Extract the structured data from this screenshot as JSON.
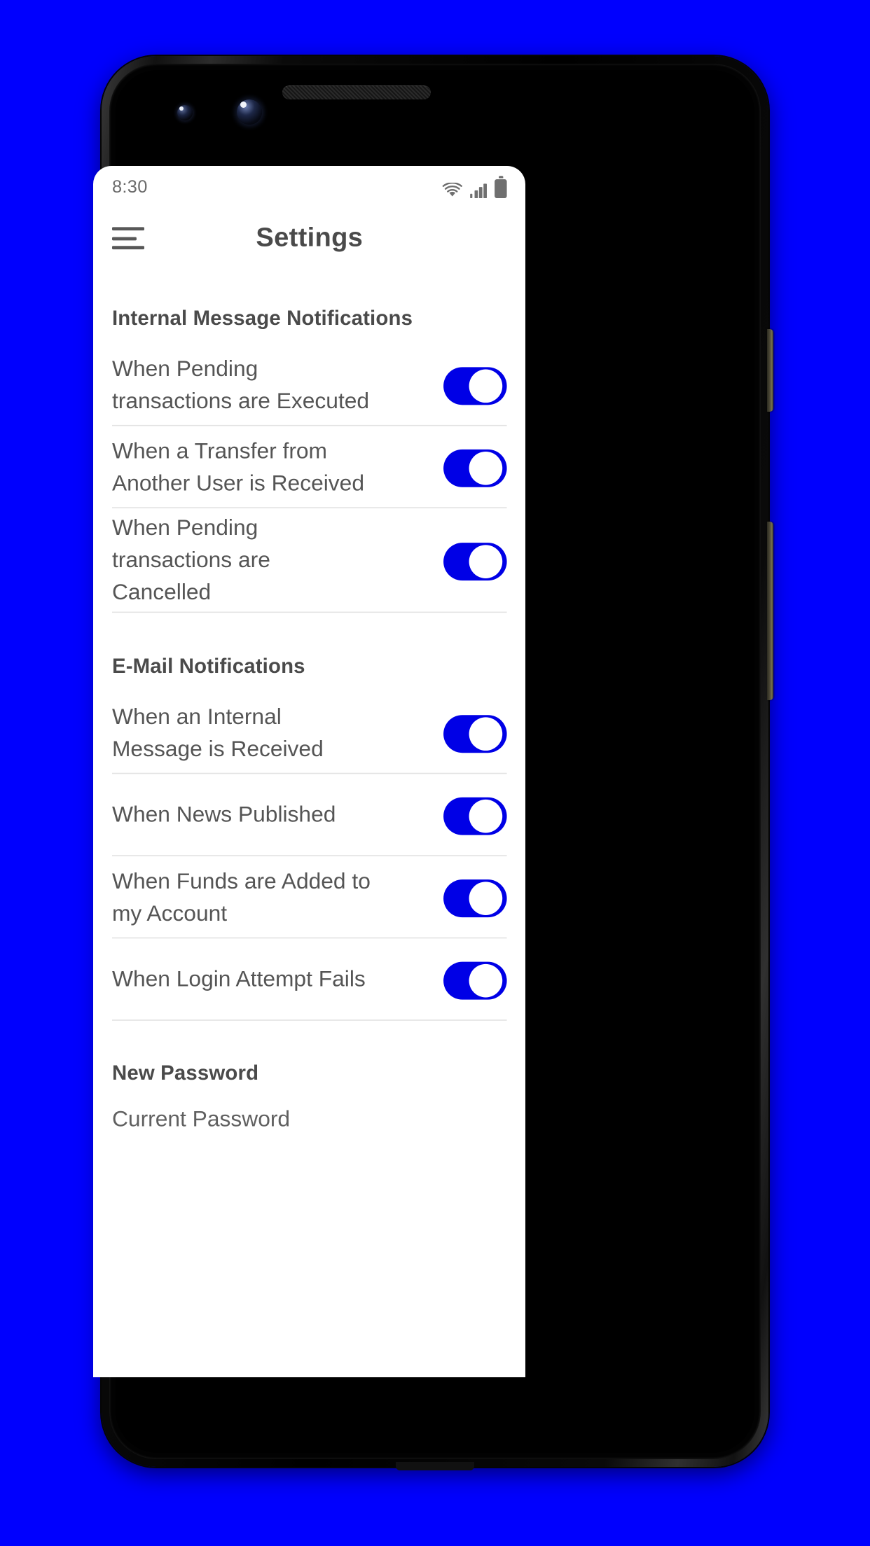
{
  "theme": {
    "background": "#0000fe",
    "accent": "#0000e6",
    "text": "#555555",
    "heading": "#4a4a4a"
  },
  "status_bar": {
    "time": "8:30",
    "icons": [
      "wifi-icon",
      "cellular-signal-icon",
      "battery-icon"
    ]
  },
  "app_bar": {
    "menu_icon": "hamburger-menu-icon",
    "title": "Settings"
  },
  "sections": [
    {
      "id": "internal-message-notifications",
      "title": "Internal Message Notifications",
      "rows": [
        {
          "label": "When Pending transactions are Executed",
          "toggle": "on"
        },
        {
          "label": "When a Transfer from Another User is Received",
          "toggle": "on"
        },
        {
          "label": "When Pending transactions are Cancelled",
          "toggle": "on"
        }
      ]
    },
    {
      "id": "email-notifications",
      "title": "E-Mail Notifications",
      "rows": [
        {
          "label": "When an Internal Message is Received",
          "toggle": "on"
        },
        {
          "label": "When News Published",
          "toggle": "on"
        },
        {
          "label": "When Funds are Added to my Account",
          "toggle": "on"
        },
        {
          "label": "When Login Attempt Fails",
          "toggle": "on"
        }
      ]
    }
  ],
  "password_section": {
    "title": "New Password",
    "current_password_label": "Current Password",
    "current_password_value": ""
  }
}
